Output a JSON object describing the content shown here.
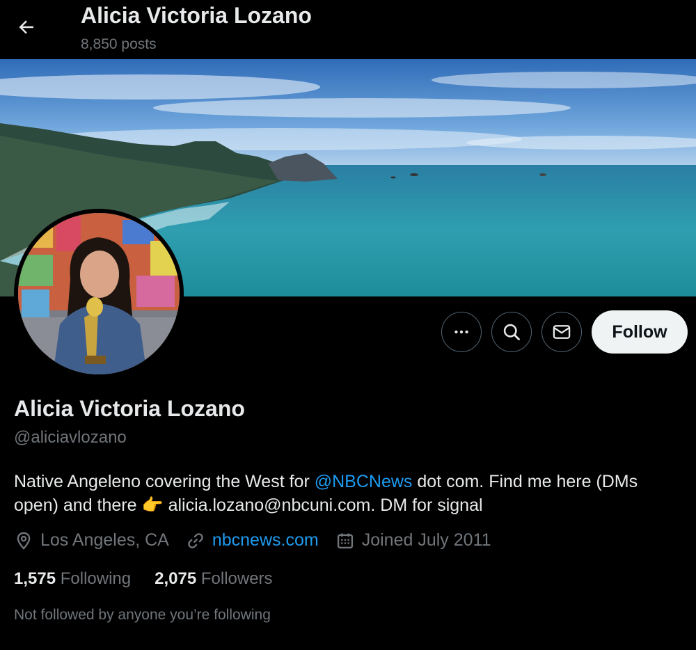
{
  "header": {
    "title": "Alicia Victoria Lozano",
    "post_count": "8,850 posts"
  },
  "actions": {
    "follow_label": "Follow"
  },
  "profile": {
    "name": "Alicia Victoria Lozano",
    "handle": "@aliciavlozano",
    "bio": {
      "part1": "Native Angeleno covering the West for ",
      "mention": "@NBCNews",
      "part2": " dot com. Find me here (DMs open) and there ",
      "emoji": "👉",
      "part3": " alicia.lozano@nbcuni.com. DM for signal"
    },
    "location": "Los Angeles, CA",
    "website": "nbcnews.com",
    "joined": "Joined July 2011",
    "following_count": "1,575",
    "following_label": "Following",
    "followers_count": "2,075",
    "followers_label": "Followers",
    "followed_by_note": "Not followed by anyone you’re following"
  },
  "colors": {
    "background": "#000000",
    "primary_text": "#e7e9ea",
    "secondary_text": "#71767b",
    "link": "#1d9bf0",
    "follow_button_bg": "#eff3f4"
  },
  "icons": [
    "back-arrow-icon",
    "more-icon",
    "search-icon",
    "mail-icon",
    "location-icon",
    "link-icon",
    "calendar-icon"
  ]
}
